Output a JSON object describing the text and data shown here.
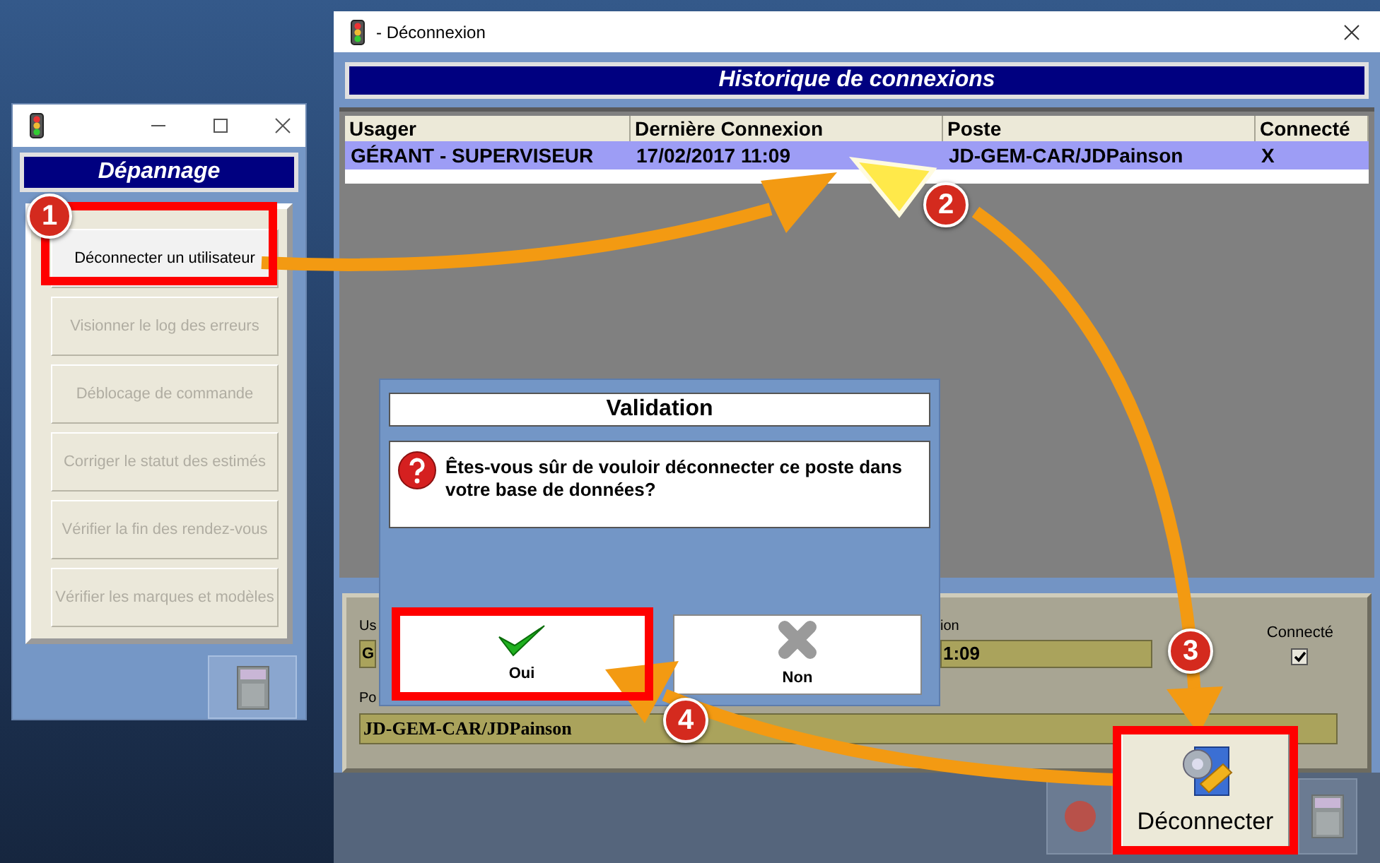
{
  "left_window": {
    "header": "Dépannage",
    "buttons": [
      {
        "label": "Déconnecter un utilisateur",
        "disabled": false
      },
      {
        "label": "Visionner le log des erreurs",
        "disabled": true
      },
      {
        "label": "Déblocage de commande",
        "disabled": true
      },
      {
        "label": "Corriger le statut des estimés",
        "disabled": true
      },
      {
        "label": "Vérifier la fin des rendez-vous",
        "disabled": true
      },
      {
        "label": "Vérifier les marques et modèles",
        "disabled": true
      }
    ]
  },
  "main_window": {
    "title": "- Déconnexion",
    "header": "Historique de connexions",
    "table": {
      "columns": [
        "Usager",
        "Dernière Connexion",
        "Poste",
        "Connecté"
      ],
      "rows": [
        {
          "cells": [
            "GÉRANT - SUPERVISEUR",
            "17/02/2017 11:09",
            "JD-GEM-CAR/JDPainson",
            "X"
          ],
          "selected": true
        }
      ]
    },
    "details": {
      "user_label": "Us",
      "user_value": "G",
      "date_label": "ion",
      "date_value": "1:09",
      "connected_label": "Connecté",
      "connected": true,
      "station_label": "Po",
      "station_value": "JD-GEM-CAR/JDPainson"
    },
    "disconnect_button": "Déconnecter"
  },
  "dialog": {
    "title": "Validation",
    "message": "Êtes-vous sûr de vouloir déconnecter ce poste dans votre base de données?",
    "buttons": [
      {
        "label": "Oui",
        "kind": "confirm"
      },
      {
        "label": "Non",
        "kind": "cancel"
      }
    ]
  },
  "steps": [
    "1",
    "2",
    "3",
    "4"
  ]
}
